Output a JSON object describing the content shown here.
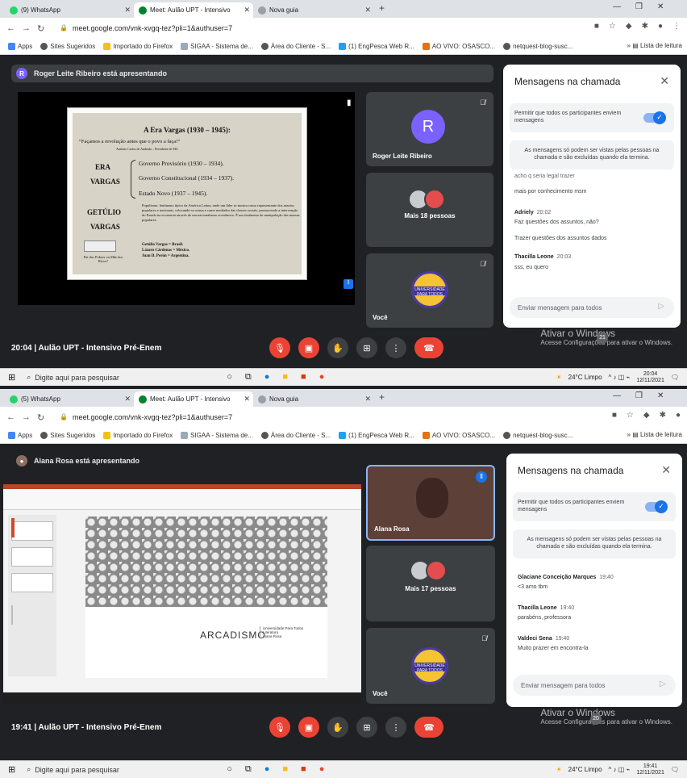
{
  "top": {
    "tabs": [
      {
        "label": "(9) WhatsApp",
        "color": "#25d366"
      },
      {
        "label": "Meet: Aulão UPT - Intensivo",
        "color": "#00832d"
      },
      {
        "label": "Nova guia",
        "color": "#5f6368"
      }
    ],
    "url": "meet.google.com/vnk-xvgq-tez?pli=1&authuser=7",
    "bookmarks": [
      "Apps",
      "Sites Sugeridos",
      "Importado do Firefox",
      "SIGAA - Sistema de...",
      "Área do Cliente - S...",
      "(1) EngPesca Web R...",
      "AO VIVO: OSASCO...",
      "netquest-blog-susc..."
    ],
    "reading_list": "Lista de leitura",
    "presenter_initial": "R",
    "presenting": "Roger Leite Ribeiro está apresentando",
    "slide": {
      "title": "A Era Vargas (1930 – 1945):",
      "quote": "“Façamos a revolução antes que o povo a faça!”",
      "author": "Antônio Carlos de Andrada – Presidente de MG",
      "label1": "ERA",
      "label2": "VARGAS",
      "items": [
        "Governo Provisório (1930 – 1934).",
        "Governo Constitucional (1934 – 1937).",
        "Estado Novo (1937 – 1945)."
      ],
      "label3": "GETÚLIO",
      "label4": "VARGAS",
      "paragraph": "Populismo: fenômeno típico da América Latina, onde um líder se mostra como representante dos anseios populares e nacionais, colocando-se acima e como mediador das classes sociais, promovendo a intervenção do Estado na economia através de um nacionalismo econômico. É um fenômeno de manipulação das massas populares.",
      "leaders": [
        "Getúlio Vargas = Brasil.",
        "Lázaro Cárdenas = México.",
        "Juan D. Perón = Argentina."
      ],
      "caption": "Pai dos Pobres ou Mãe dos Ricos?"
    },
    "tiles": [
      {
        "name": "Roger Leite Ribeiro",
        "initial": "R"
      },
      {
        "name": "Mais 18 pessoas"
      },
      {
        "name": "Você"
      }
    ],
    "logo_text": "UNIVERSIDADE PARA TODOS",
    "chat": {
      "title": "Mensagens na chamada",
      "permit": "Permitir que todos os participantes enviem mensagens",
      "info": "As mensagens só podem ser vistas pelas pessoas na chamada e são excluídas quando ela termina.",
      "messages": [
        {
          "who": "",
          "time": "",
          "lines": [
            "acho q seria legal trazer",
            "mais por conhecimento msm"
          ]
        },
        {
          "who": "Adriely",
          "time": "20:02",
          "lines": [
            "Faz questões dos assuntos, não?",
            "Trazer questões dos assuntos dados"
          ]
        },
        {
          "who": "Thacilla Leone",
          "time": "20:03",
          "lines": [
            "sss, eu quero"
          ]
        }
      ],
      "placeholder": "Enviar mensagem para todos"
    },
    "meeting": "20:04  |  Aulão UPT - Intensivo Pré-Enem",
    "participants_badge": "21",
    "watermark1": "Ativar o Windows",
    "watermark2": "Acesse Configurações para ativar o Windows.",
    "taskbar": {
      "search": "Digite aqui para pesquisar",
      "weather": "24°C  Limpo",
      "time": "20:04",
      "date": "12/11/2021"
    }
  },
  "bottom": {
    "tabs": [
      {
        "label": "(5) WhatsApp",
        "color": "#25d366"
      },
      {
        "label": "Meet: Aulão UPT - Intensivo",
        "color": "#00832d"
      },
      {
        "label": "Nova guia",
        "color": "#5f6368"
      }
    ],
    "url": "meet.google.com/vnk-xvgq-tez?pli=1&authuser=7",
    "presenting": "Alana Rosa está apresentando",
    "ppt_title": "ARCADISMO",
    "ppt_sub": "Universidade Para Todos\nLiteratura\nAlana Rosa",
    "tiles": [
      {
        "name": "Alana Rosa"
      },
      {
        "name": "Mais 17 pessoas"
      },
      {
        "name": "Você"
      }
    ],
    "chat": {
      "title": "Mensagens na chamada",
      "permit": "Permitir que todos os participantes enviem mensagens",
      "info": "As mensagens só podem ser vistas pelas pessoas na chamada e são excluídas quando ela termina.",
      "messages": [
        {
          "who": "Glaciane Conceição Marques",
          "time": "19:40",
          "lines": [
            "<3 amo tbm"
          ]
        },
        {
          "who": "Thacilla Leone",
          "time": "19:40",
          "lines": [
            "parabéns, professora"
          ]
        },
        {
          "who": "Valdeci Sena",
          "time": "19:40",
          "lines": [
            "Muito prazer em encontra-la"
          ]
        }
      ],
      "placeholder": "Enviar mensagem para todos"
    },
    "meeting": "19:41  |  Aulão UPT - Intensivo Pré-Enem",
    "participants_badge": "20",
    "watermark1": "Ativar o Windows",
    "watermark2": "Acesse Configurações para ativar o Windows.",
    "taskbar": {
      "search": "Digite aqui para pesquisar",
      "weather": "24°C  Limpo",
      "time": "19:41",
      "date": "12/11/2021"
    }
  }
}
